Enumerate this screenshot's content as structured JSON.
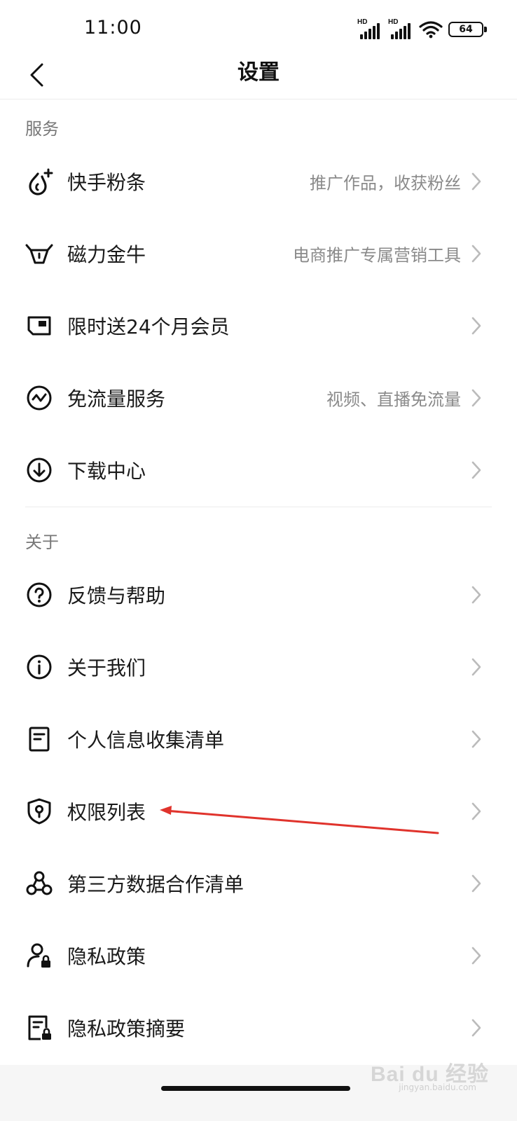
{
  "status_bar": {
    "time": "11:00",
    "battery": "64"
  },
  "nav": {
    "title": "设置"
  },
  "sections": [
    {
      "title": "服务",
      "items": [
        {
          "label": "快手粉条",
          "sub": "推广作品，收获粉丝"
        },
        {
          "label": "磁力金牛",
          "sub": "电商推广专属营销工具"
        },
        {
          "label": "限时送24个月会员",
          "sub": ""
        },
        {
          "label": "免流量服务",
          "sub": "视频、直播免流量"
        },
        {
          "label": "下载中心",
          "sub": ""
        }
      ]
    },
    {
      "title": "关于",
      "items": [
        {
          "label": "反馈与帮助",
          "sub": ""
        },
        {
          "label": "关于我们",
          "sub": ""
        },
        {
          "label": "个人信息收集清单",
          "sub": ""
        },
        {
          "label": "权限列表",
          "sub": ""
        },
        {
          "label": "第三方数据合作清单",
          "sub": ""
        },
        {
          "label": "隐私政策",
          "sub": ""
        },
        {
          "label": "隐私政策摘要",
          "sub": ""
        }
      ]
    }
  ],
  "watermark": {
    "text": "Bai du 经验",
    "sub": "jingyan.baidu.com"
  },
  "colors": {
    "annotation_arrow": "#e0332c"
  }
}
